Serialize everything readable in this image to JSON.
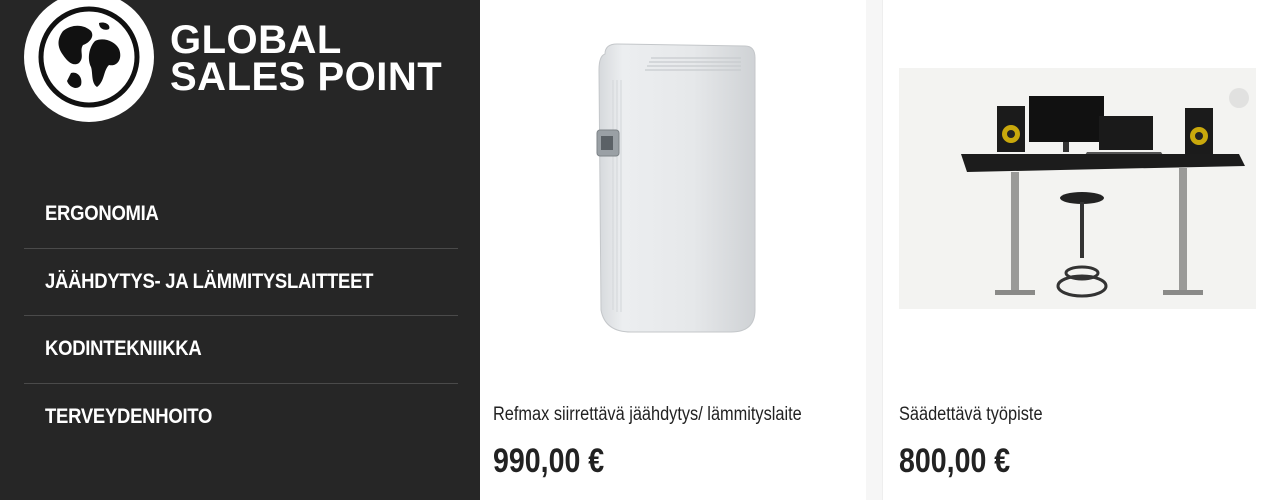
{
  "brand": {
    "line1": "GLOBAL",
    "line2": "SALES POINT",
    "logo_icon": "globe-icon"
  },
  "nav": {
    "items": [
      {
        "label": "ERGONOMIA"
      },
      {
        "label": "JÄÄHDYTYS- JA LÄMMITYSLAITTEET"
      },
      {
        "label": "KODINTEKNIIKKA"
      },
      {
        "label": "TERVEYDENHOITO"
      }
    ]
  },
  "products": [
    {
      "name": "Refmax siirrettävä jäähdytys/ lämmityslaite",
      "price": "990,00 €",
      "image": "portable-ac-unit-image"
    },
    {
      "name": "Säädettävä työpiste",
      "price": "800,00 €",
      "image": "adjustable-desk-image"
    }
  ],
  "colors": {
    "sidebar": "#262626",
    "text": "#222222"
  }
}
